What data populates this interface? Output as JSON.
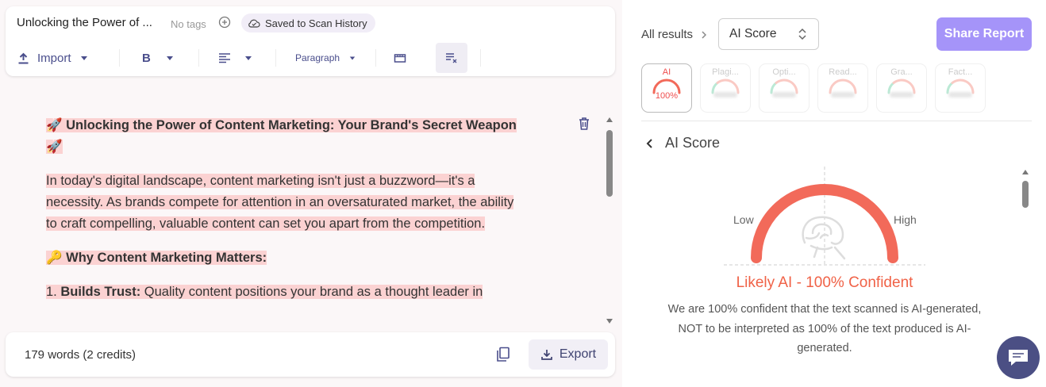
{
  "editor": {
    "doc_title": "Unlocking the Power of ...",
    "no_tags": "No tags",
    "saved_label": "Saved to Scan History",
    "toolbar": {
      "import_label": "Import",
      "bold_label": "B",
      "paragraph_label": "Paragraph"
    },
    "content": {
      "heading_emoji_start": "🚀",
      "heading": "Unlocking the Power of Content Marketing: Your Brand's Secret Weapon",
      "heading_emoji_end": "🚀",
      "paragraph1": "In today's digital landscape, content marketing isn't just a buzzword—it's a necessity. As brands compete for attention in an oversaturated market, the ability to craft compelling, valuable content can set you apart from the competition.",
      "subheading_emoji": "🔑",
      "subheading": "Why Content Marketing Matters:",
      "list_item_number": "1.",
      "list_item_title": "Builds Trust:",
      "list_item_text": "Quality content positions your brand as a thought leader in"
    },
    "footer": {
      "word_count": "179 words (2 credits)",
      "export_label": "Export"
    }
  },
  "results": {
    "all_results_label": "All results",
    "select_value": "AI Score",
    "share_label": "Share Report",
    "cards": [
      {
        "label": "AI",
        "value": "100%",
        "active": true
      },
      {
        "label": "Plagi...",
        "active": false
      },
      {
        "label": "Opti...",
        "active": false
      },
      {
        "label": "Read...",
        "active": false
      },
      {
        "label": "Gra...",
        "active": false
      },
      {
        "label": "Fact...",
        "active": false
      }
    ],
    "section_title": "AI Score",
    "gauge": {
      "low_label": "Low",
      "high_label": "High",
      "score": 1.0
    },
    "verdict": "Likely AI - 100% Confident",
    "description": "We are 100% confident that the text scanned is AI-generated, NOT to be interpreted as 100% of the text produced is AI-generated."
  },
  "colors": {
    "accent": "#a594f9",
    "highlight": "#fbd2d2",
    "gauge": "#f26a5a",
    "verdict": "#f06247",
    "chat": "#4b4f84"
  },
  "icons": {
    "add_tag": "plus-circle-icon",
    "saved": "cloud-check-icon",
    "import": "upload-icon",
    "align": "align-left-icon",
    "media": "film-icon",
    "clear_format": "clear-format-icon",
    "trash": "trash-icon",
    "copy": "copy-icon",
    "export": "download-icon",
    "chevron_right": "chevron-right-icon",
    "chevron_left": "chevron-left-icon",
    "chat": "chat-icon"
  }
}
